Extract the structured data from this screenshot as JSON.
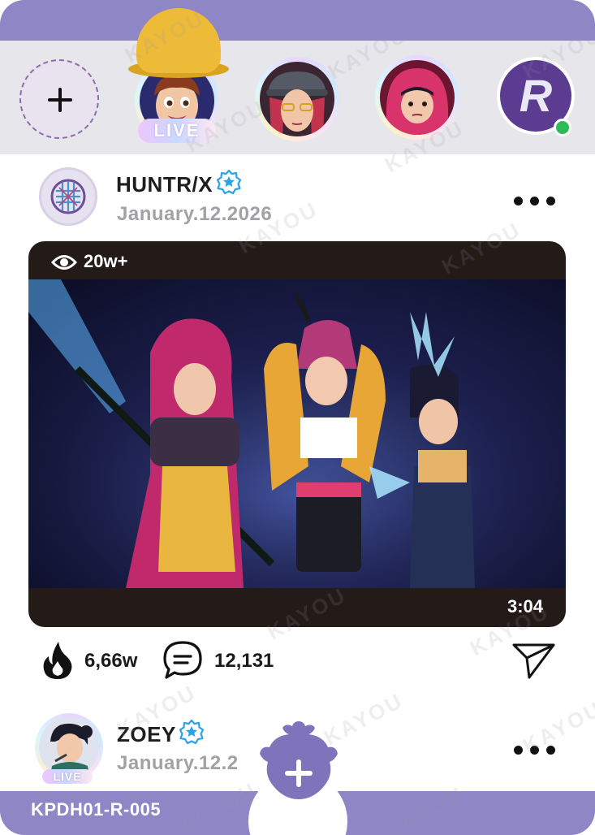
{
  "colors": {
    "accent": "#8f86c6",
    "stories_bg": "#e7e6eb",
    "video_frame": "#241b19",
    "online": "#2dbb55",
    "verified": "#2aa3e6"
  },
  "stories": {
    "add_icon": "plus-icon",
    "live_label": "LIVE",
    "brand_letter": "R"
  },
  "post": {
    "author": "HUNTR/X",
    "date": "January.12.2026",
    "views": "20w+",
    "duration": "3:04",
    "likes": "6,66w",
    "comments": "12,131",
    "like_icon": "flame-icon",
    "comment_icon": "chat-bubble-icon",
    "share_icon": "paper-plane-icon"
  },
  "next_post": {
    "author": "ZOEY",
    "date": "January.12.2",
    "live_label": "LIVE"
  },
  "footer": {
    "card_code": "KPDH01-R-005",
    "fab_icon": "plus-icon"
  },
  "watermark": "KAYOU"
}
